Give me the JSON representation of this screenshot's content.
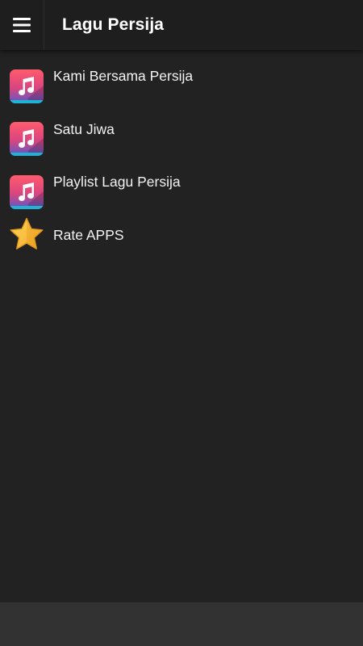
{
  "app_bar": {
    "title": "Lagu Persija",
    "menu_icon": "hamburger-menu-icon"
  },
  "menu": {
    "items": [
      {
        "label": "Kami Bersama Persija",
        "icon": "music-note-icon"
      },
      {
        "label": "Satu Jiwa",
        "icon": "music-note-icon"
      },
      {
        "label": "Playlist Lagu Persija",
        "icon": "music-note-icon"
      },
      {
        "label": "Rate APPS",
        "icon": "star-icon"
      }
    ]
  },
  "colors": {
    "background": "#222222",
    "app_bar": "#1e1e1e",
    "bottom_bar": "#323232",
    "text": "#f2f2f2",
    "star": "#ffc83a"
  }
}
